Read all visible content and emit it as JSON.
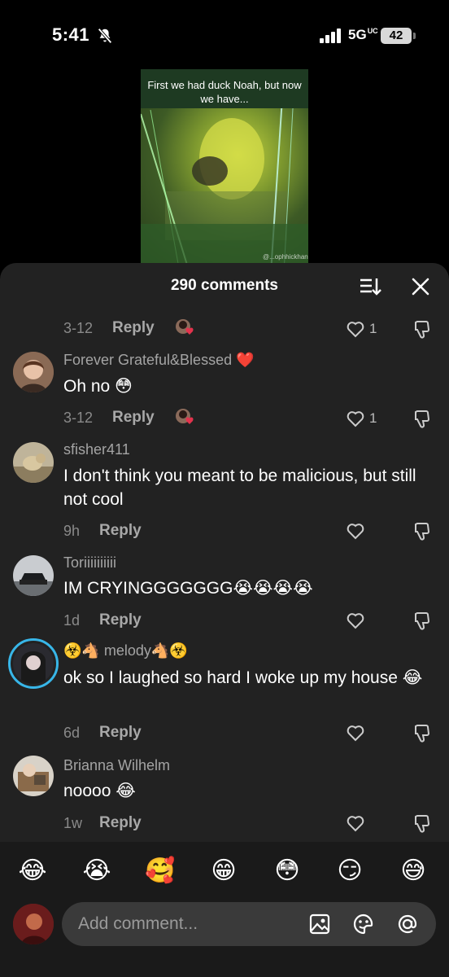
{
  "status_bar": {
    "time": "5:41",
    "network": "5G",
    "network_sup": "UC",
    "battery": "42"
  },
  "video": {
    "caption": "First we had duck Noah, but now we have...",
    "watermark": "@...ophhickhan"
  },
  "panel": {
    "title": "290 comments"
  },
  "comments": [
    {
      "time": "3-12",
      "reply": "Reply",
      "likes": "1"
    },
    {
      "username": "Forever Grateful&Blessed ❤️",
      "text": "Oh no 😳",
      "time": "3-12",
      "reply": "Reply",
      "likes": "1"
    },
    {
      "username": "sfisher411",
      "text": "I don't think you meant to be malicious, but still not cool",
      "time": "9h",
      "reply": "Reply"
    },
    {
      "username": "Toriiiiiiiiii",
      "text": "IM CRYINGGGGGGG😭😭😭😭",
      "time": "1d",
      "reply": "Reply"
    },
    {
      "username": "☣️🐴 melody🐴☣️",
      "text": "ok so I laughed so hard I woke up my house 😂",
      "time": "6d",
      "reply": "Reply"
    },
    {
      "username": "Brianna Wilhelm",
      "text": "noooo 😂",
      "time": "1w",
      "reply": "Reply"
    }
  ],
  "emoji_bar": [
    "😂",
    "😭",
    "🥰",
    "😁",
    "😳",
    "😏",
    "😅"
  ],
  "input": {
    "placeholder": "Add comment..."
  },
  "colors": {
    "panel": "#222222",
    "emoji_bar": "#1a1a1a",
    "story_ring": "#38b6e8",
    "like_red": "#e3334d"
  }
}
